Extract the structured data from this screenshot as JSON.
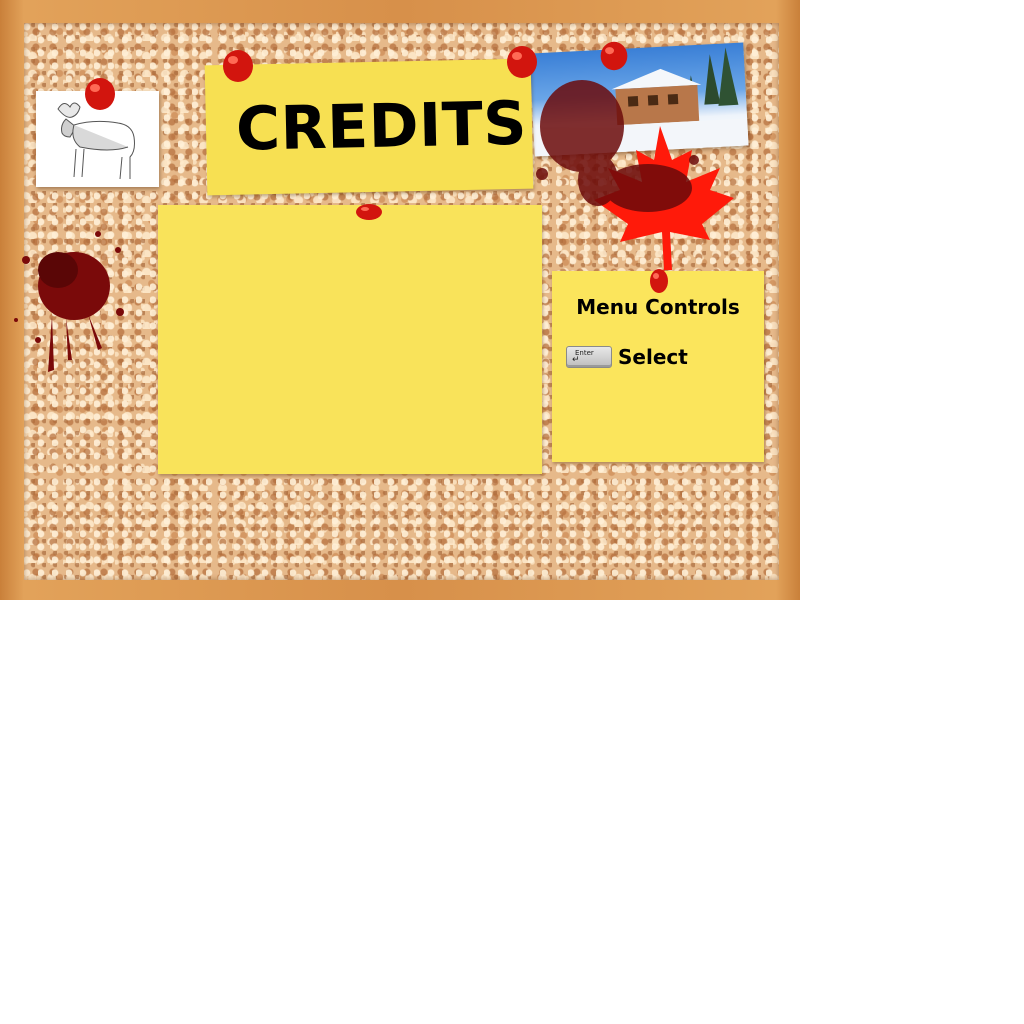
{
  "title": "CREDITS",
  "credits": {
    "entries": []
  },
  "menu_controls": {
    "title": "Menu Controls",
    "key_label": "Enter",
    "action_label": "Select"
  },
  "colors": {
    "note_yellow": "#f9e35a",
    "pin_red": "#d2150e",
    "cork": "#e6b98a",
    "frame": "#d7904a",
    "maple_red": "#ff1a0a",
    "blood": "#7a0a0a"
  },
  "icons": [
    "push-pin-icon",
    "moose-icon",
    "maple-leaf-icon",
    "enter-key-icon",
    "cabin-photo",
    "blood-splatter"
  ]
}
